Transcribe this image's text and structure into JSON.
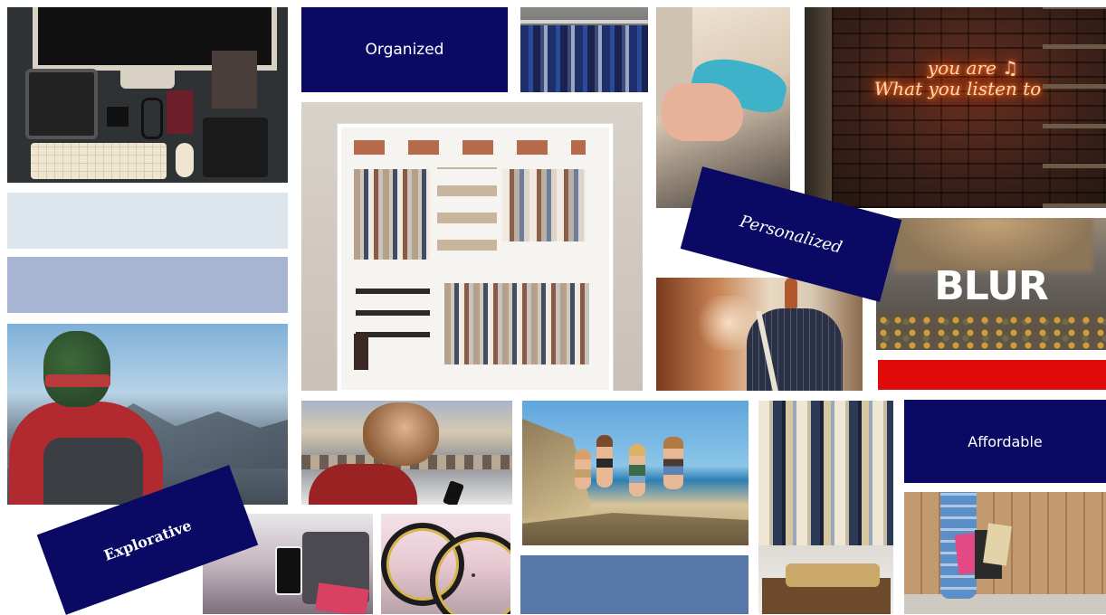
{
  "labels": {
    "organized": "Organized",
    "personalized": "Personalized",
    "explorative": "Explorative",
    "affordable": "Affordable"
  },
  "photo_text": {
    "neon_line1": "you are ♫",
    "neon_line2": "What you listen to",
    "blur_title": "BLUR"
  },
  "colors": {
    "label_navy": "#0a0a64",
    "pale_blue": "#dde6ed",
    "lavender_blue": "#a7b4d2",
    "mid_blue": "#5677a7",
    "red": "#e00a0a"
  }
}
